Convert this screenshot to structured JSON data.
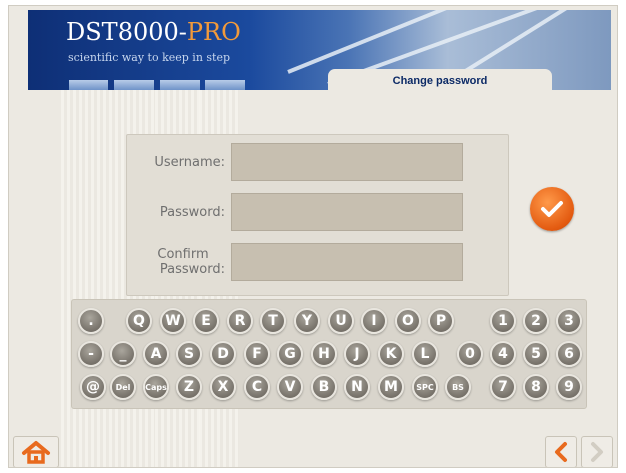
{
  "header": {
    "brand_main": "DST8000-",
    "brand_pro": "PRO",
    "tagline": "scientific way to keep in step",
    "screen_title": "Change password"
  },
  "form": {
    "username_label": "Username:",
    "username_value": "",
    "password_label": "Password:",
    "password_value": "",
    "confirm_label_line1": "Confirm",
    "confirm_label_line2": "Password:",
    "confirm_value": ""
  },
  "confirm_button": {
    "icon": "checkmark-icon"
  },
  "keyboard": {
    "row1": [
      ".",
      "Q",
      "W",
      "E",
      "R",
      "T",
      "Y",
      "U",
      "I",
      "O",
      "P",
      "1",
      "2",
      "3"
    ],
    "row2": [
      "-",
      "_",
      "A",
      "S",
      "D",
      "F",
      "G",
      "H",
      "J",
      "K",
      "L",
      "0",
      "4",
      "5",
      "6"
    ],
    "row3": [
      "@",
      "Del",
      "Caps",
      "Z",
      "X",
      "C",
      "V",
      "B",
      "N",
      "M",
      "SPC",
      "BS",
      "7",
      "8",
      "9"
    ]
  },
  "nav": {
    "home_icon": "home-icon",
    "back_icon": "chevron-left-icon",
    "forward_icon": "chevron-right-icon"
  },
  "colors": {
    "accent_orange": "#f07020",
    "brand_blue": "#0e2f76",
    "key_gray": "#77726a",
    "background": "#ece9e2"
  }
}
